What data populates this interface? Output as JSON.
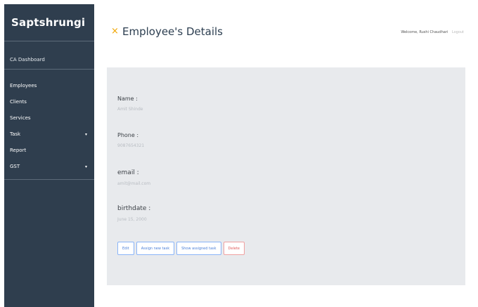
{
  "sidebar": {
    "brand": "Saptshrungi",
    "dashboard": "CA Dashboard",
    "items": [
      {
        "label": "Employees",
        "caret": ""
      },
      {
        "label": "Clients",
        "caret": ""
      },
      {
        "label": "Services",
        "caret": ""
      },
      {
        "label": "Task",
        "caret": "▾"
      },
      {
        "label": "Report",
        "caret": ""
      },
      {
        "label": "GST",
        "caret": "▾"
      }
    ]
  },
  "header": {
    "title": "Employee's Details",
    "welcome": "Welcome, Rushi Chaudhari",
    "logout": "Logout"
  },
  "details": {
    "name_label": "Name :",
    "name_value": "Amit Shinde",
    "phone_label": "Phone :",
    "phone_value": "9087654321",
    "email_label": "email :",
    "email_value": "amit@mail.com",
    "birthdate_label": "birthdate :",
    "birthdate_value": "June 15, 2000"
  },
  "actions": {
    "edit": "Edit",
    "assign": "Assign new task",
    "show": "Show assigned task",
    "delete": "Delete"
  }
}
